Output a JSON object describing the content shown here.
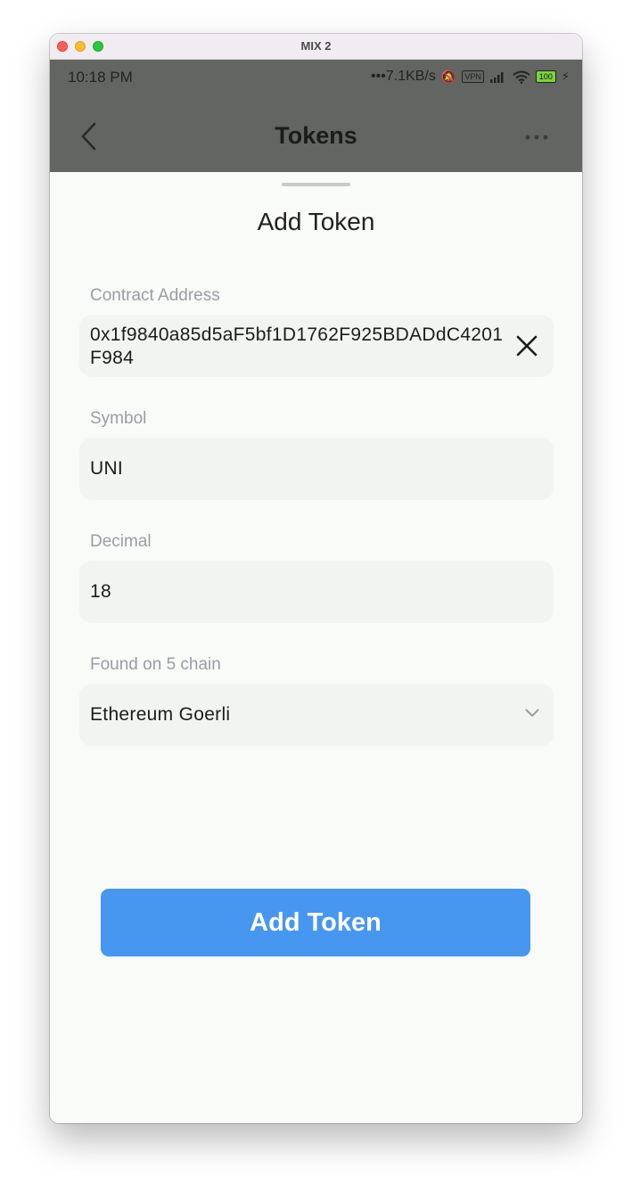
{
  "window": {
    "title": "MIX 2"
  },
  "statusbar": {
    "time": "10:18 PM",
    "speed": "7.1KB/s",
    "vpn": "VPN",
    "battery": "100"
  },
  "header": {
    "title": "Tokens"
  },
  "sheet": {
    "title": "Add Token",
    "contract": {
      "label": "Contract Address",
      "value": "0x1f9840a85d5aF5bf1D1762F925BDADdC4201F984"
    },
    "symbol": {
      "label": "Symbol",
      "value": "UNI"
    },
    "decimal": {
      "label": "Decimal",
      "value": "18"
    },
    "chain": {
      "label": "Found on 5 chain",
      "value": "Ethereum Goerli"
    },
    "submit_label": "Add Token"
  },
  "colors": {
    "accent": "#4797f0",
    "header_bg": "#636563",
    "sheet_bg": "#f9fbf9",
    "field_bg": "#f2f4f2"
  }
}
